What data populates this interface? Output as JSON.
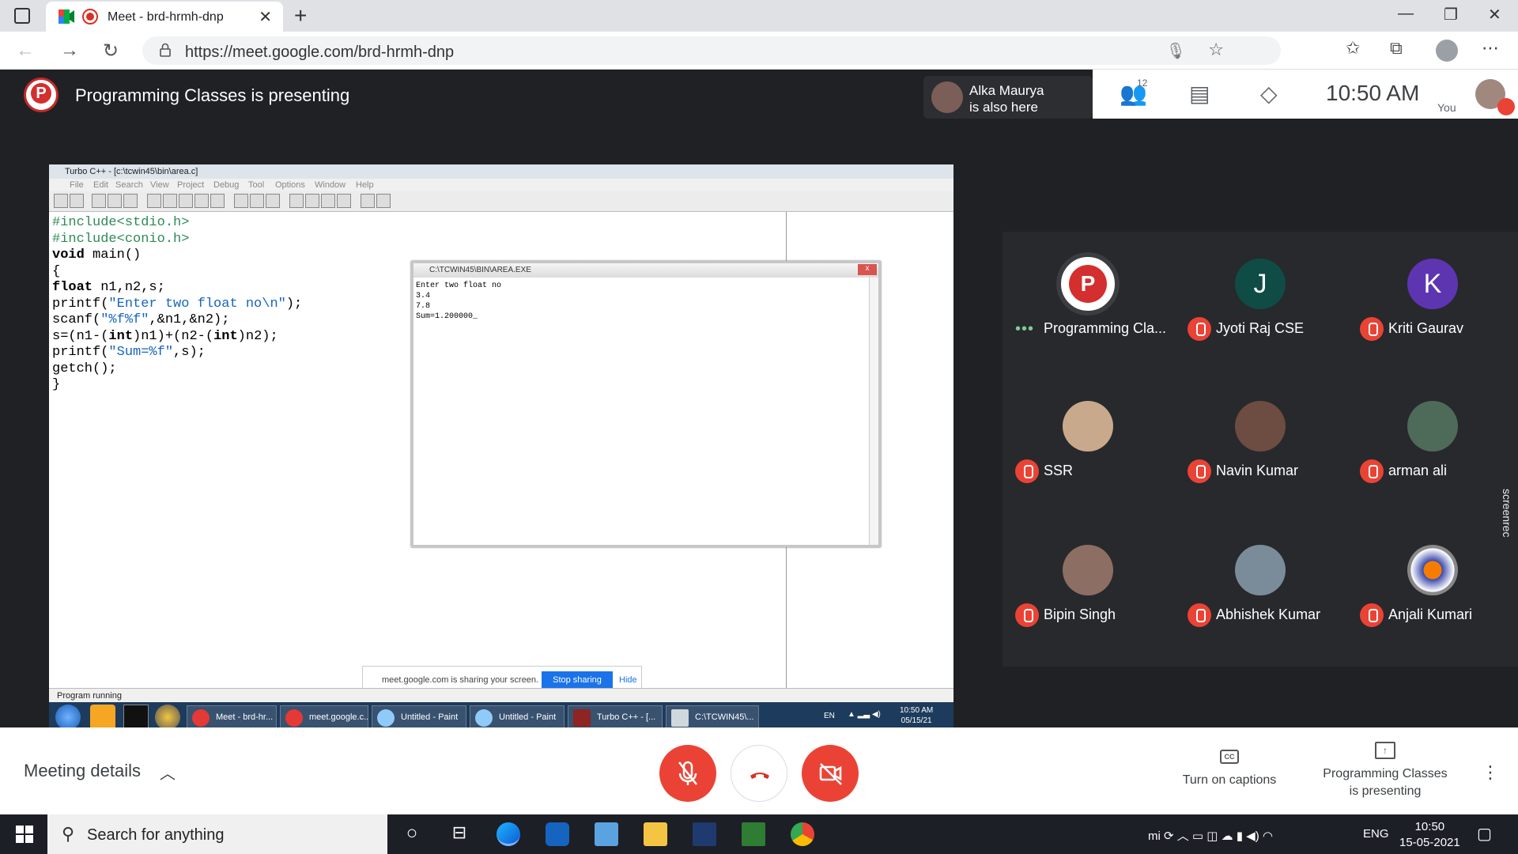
{
  "browser": {
    "tab_title": "Meet - brd-hrmh-dnp",
    "url": "https://meet.google.com/brd-hrmh-dnp",
    "icons": [
      "window-icon",
      "meet-favicon",
      "recording-icon",
      "close-tab-icon",
      "new-tab-icon",
      "back-icon",
      "forward-icon",
      "reload-icon",
      "lock-icon",
      "mic-icon",
      "star-icon",
      "favorites-icon",
      "collections-icon",
      "profile-icon",
      "more-icon"
    ]
  },
  "meet": {
    "presenting_title": "Programming Classes is presenting",
    "also_here_name": "Alka Maurya",
    "also_here_suffix": "is also here",
    "people_count": "12",
    "clock": "10:50 AM",
    "you_label": "You",
    "accent": "#1a73e8",
    "danger": "#ea4335",
    "participants": [
      {
        "name": "Programming Cla...",
        "kind": "logo",
        "muted": false
      },
      {
        "name": "Jyoti Raj CSE",
        "kind": "letter",
        "letter": "J",
        "color": "#0f4c45",
        "muted": true
      },
      {
        "name": "Kriti Gaurav",
        "kind": "letter",
        "letter": "K",
        "color": "#5e35b1",
        "muted": true
      },
      {
        "name": "SSR",
        "kind": "photo",
        "color": "#c9a98b",
        "muted": true
      },
      {
        "name": "Navin Kumar",
        "kind": "photo",
        "color": "#6d4c41",
        "muted": true
      },
      {
        "name": "arman ali",
        "kind": "photo",
        "color": "#4e6b5a",
        "muted": true
      },
      {
        "name": "Bipin Singh",
        "kind": "photo",
        "color": "#8d6e63",
        "muted": true
      },
      {
        "name": "Abhishek Kumar",
        "kind": "photo",
        "color": "#7a8c9a",
        "muted": true
      },
      {
        "name": "Anjali Kumari",
        "kind": "logo2",
        "color": "#3949ab",
        "muted": true
      }
    ],
    "screenrec": "screenrec"
  },
  "shared": {
    "window_title": "Turbo C++ - [c:\\tcwin45\\bin\\area.c]",
    "menu": [
      "File",
      "Edit",
      "Search",
      "View",
      "Project",
      "Debug",
      "Tool",
      "Options",
      "Window",
      "Help"
    ],
    "code": {
      "l1": "#include<stdio.h>",
      "l2": "#include<conio.h>",
      "l3a": "void",
      "l3b": " main()",
      "l4": "{",
      "l5a": "float",
      "l5b": " n1,n2,s;",
      "l6a": "printf(",
      "l6b": "\"Enter two float no\\n\"",
      "l6c": ");",
      "l7a": "scanf(",
      "l7b": "\"%f%f\"",
      "l7c": ",&n1,&n2);",
      "l8a": "s=(n1-(",
      "l8b": "int",
      "l8c": ")n1)+(n2-(",
      "l8d": "int",
      "l8e": ")n2);",
      "l9a": "printf(",
      "l9b": "\"Sum=%f\"",
      "l9c": ",s);",
      "l10": "getch();",
      "l11": "}"
    },
    "console_title": "C:\\TCWIN45\\BIN\\AREA.EXE",
    "console_output": "Enter two float no\n3.4\n7.8\nSum=1.200000_",
    "status": "Program running",
    "share_msg": "meet.google.com is sharing your screen.",
    "stop_sharing": "Stop sharing",
    "hide": "Hide",
    "tasks": [
      "Meet - brd-hr...",
      "meet.google.c...",
      "Untitled - Paint",
      "Untitled - Paint",
      "Turbo C++ - [...",
      "C:\\TCWIN45\\..."
    ],
    "tray_lang": "EN",
    "tray_time": "10:50 AM",
    "tray_date": "05/15/21"
  },
  "bottom": {
    "meeting_details": "Meeting details",
    "captions": "Turn on captions",
    "presenting_line1": "Programming Classes",
    "presenting_line2": "is presenting"
  },
  "taskbar": {
    "search_placeholder": "Search for anything",
    "lang": "ENG",
    "time": "10:50",
    "date": "15-05-2021"
  }
}
